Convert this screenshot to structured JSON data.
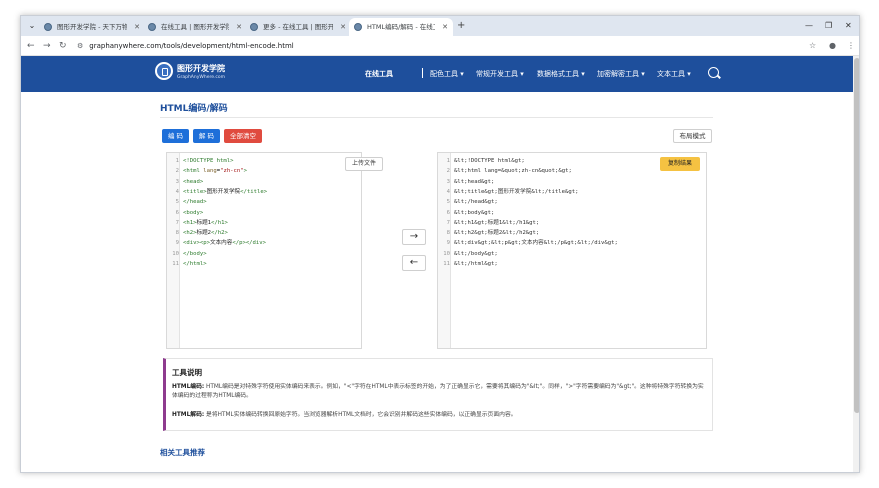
{
  "browser": {
    "tabs": [
      {
        "title": "图形开发学院 - 天下万物，无所..."
      },
      {
        "title": "在线工具 | 图形开发学院"
      },
      {
        "title": "更多 - 在线工具 | 图形开发学院"
      },
      {
        "title": "HTML编码/解码 - 在线工具 | 图..."
      }
    ],
    "new_tab": "+",
    "url": "graphanywhere.com/tools/development/html-encode.html"
  },
  "site": {
    "logo_main": "图形开发学院",
    "logo_sub": "GraphAnyWhere.com",
    "nav": {
      "home": "在线工具",
      "items": [
        "配色工具 ▾",
        "常规开发工具 ▾",
        "数据格式工具 ▾",
        "加密解密工具 ▾",
        "文本工具 ▾"
      ]
    }
  },
  "page": {
    "title": "HTML编码/解码",
    "buttons": {
      "encode": "编 码",
      "decode": "解 码",
      "clear": "全部清空",
      "layout": "布局模式",
      "upload": "上传文件",
      "copy": "复制结果"
    },
    "arrows": {
      "right": "→",
      "left": "←"
    },
    "input_lines": [
      {
        "n": "1",
        "html": "<span class='tag'>&lt;!DOCTYPE html&gt;</span>"
      },
      {
        "n": "2",
        "html": "<span class='tag'>&lt;html</span> <span class='attr'>lang</span>=<span class='str'>\"zh-cn\"</span><span class='tag'>&gt;</span>"
      },
      {
        "n": "3",
        "html": "<span class='tag'>&lt;head&gt;</span>"
      },
      {
        "n": "4",
        "html": "<span class='tag'>&lt;title&gt;</span><span class='txt'>图形开发学院</span><span class='tag'>&lt;/title&gt;</span>"
      },
      {
        "n": "5",
        "html": "<span class='tag'>&lt;/head&gt;</span>"
      },
      {
        "n": "6",
        "html": "<span class='tag'>&lt;body&gt;</span>"
      },
      {
        "n": "7",
        "html": "<span class='tag'>&lt;h1&gt;</span><span class='txt'>标题1</span><span class='tag'>&lt;/h1&gt;</span>"
      },
      {
        "n": "8",
        "html": "<span class='tag'>&lt;h2&gt;</span><span class='txt'>标题2</span><span class='tag'>&lt;/h2&gt;</span>"
      },
      {
        "n": "9",
        "html": "<span class='tag'>&lt;div&gt;&lt;p&gt;</span><span class='txt'>文本内容</span><span class='tag'>&lt;/p&gt;&lt;/div&gt;</span>"
      },
      {
        "n": "10",
        "html": "<span class='tag'>&lt;/body&gt;</span>"
      },
      {
        "n": "11",
        "html": "<span class='tag'>&lt;/html&gt;</span>"
      }
    ],
    "output_lines": [
      {
        "n": "1",
        "text": "&lt;!DOCTYPE html&gt;"
      },
      {
        "n": "2",
        "text": "&lt;html lang=&quot;zh-cn&quot;&gt;"
      },
      {
        "n": "3",
        "text": "&lt;head&gt;"
      },
      {
        "n": "4",
        "text": "&lt;title&gt;图形开发学院&lt;/title&gt;"
      },
      {
        "n": "5",
        "text": "&lt;/head&gt;"
      },
      {
        "n": "6",
        "text": "&lt;body&gt;"
      },
      {
        "n": "7",
        "text": "&lt;h1&gt;标题1&lt;/h1&gt;"
      },
      {
        "n": "8",
        "text": "&lt;h2&gt;标题2&lt;/h2&gt;"
      },
      {
        "n": "9",
        "text": "&lt;div&gt;&lt;p&gt;文本内容&lt;/p&gt;&lt;/div&gt;"
      },
      {
        "n": "10",
        "text": "&lt;/body&gt;"
      },
      {
        "n": "11",
        "text": "&lt;/html&gt;"
      }
    ],
    "info": {
      "heading": "工具说明",
      "encode_label": "HTML编码:",
      "encode_text": "HTML编码是对特殊字符使用实体编码来表示。例如，\"<\"字符在HTML中表示标签的开始，为了正确显示它，需要将其编码为\"&lt;\"。同样，\">\"字符需要编码为\"&gt;\"。这种将特殊字符转换为实体编码的过程称为HTML编码。",
      "decode_label": "HTML解码:",
      "decode_text": "是将HTML实体编码转换回原始字符。当浏览器解析HTML文档时，它会识别并解码这些实体编码，以正确显示页面内容。"
    },
    "related_title": "相关工具推荐"
  },
  "colors": {
    "header": "#1e4f9c",
    "primary_button": "#1e6fd9",
    "danger_button": "#e04b3f",
    "copy_button": "#f5c242",
    "accent_border": "#8e3b8e"
  }
}
